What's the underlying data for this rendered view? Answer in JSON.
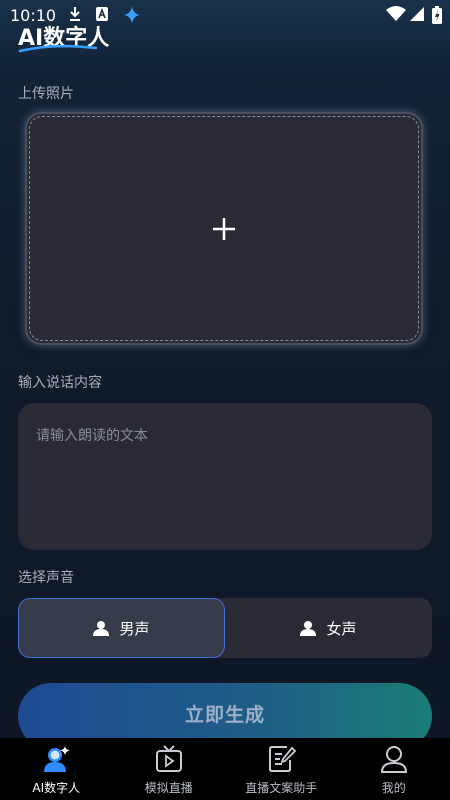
{
  "status_bar": {
    "time": "10:10"
  },
  "app": {
    "logo_text": "AI数字人"
  },
  "upload": {
    "label": "上传照片",
    "icon": "plus-icon"
  },
  "speech": {
    "label": "输入说话内容",
    "placeholder": "请输入朗读的文本",
    "value": ""
  },
  "voice": {
    "label": "选择声音",
    "options": [
      {
        "label": "男声",
        "icon": "person-icon",
        "selected": true
      },
      {
        "label": "女声",
        "icon": "person-icon",
        "selected": false
      }
    ]
  },
  "generate": {
    "label": "立即生成"
  },
  "tabbar": {
    "items": [
      {
        "label": "AI数字人",
        "icon": "ai-avatar-icon",
        "active": true
      },
      {
        "label": "模拟直播",
        "icon": "tv-play-icon",
        "active": false
      },
      {
        "label": "直播文案助手",
        "icon": "edit-document-icon",
        "active": false
      },
      {
        "label": "我的",
        "icon": "user-icon",
        "active": false
      }
    ]
  },
  "colors": {
    "accent": "#3d6fd6",
    "card": "#2a2a35",
    "background": "#101a2a"
  }
}
